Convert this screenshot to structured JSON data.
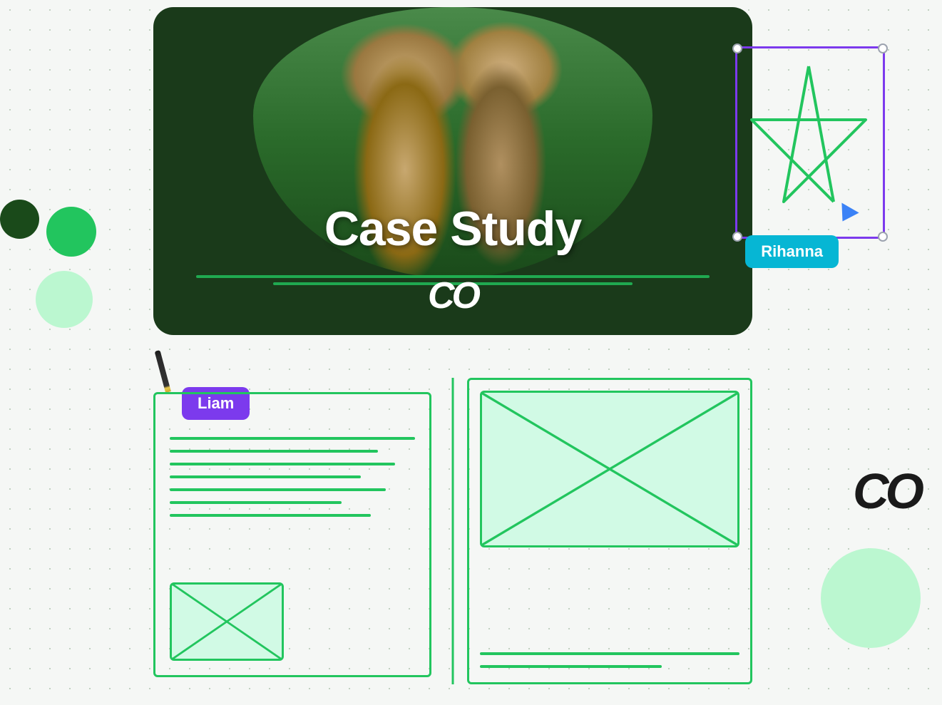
{
  "page": {
    "background_color": "#f5f7f5"
  },
  "decorations": {
    "circle_dark_color": "#1a4a1a",
    "circle_med_color": "#22c55e",
    "circle_light_color": "#bbf7d0",
    "circle_large_light_color": "#bbf7d0"
  },
  "case_study_card": {
    "title": "Case Study",
    "logo": "CO",
    "background": "#1a3a1a"
  },
  "badges": {
    "rihanna": "Rihanna",
    "liam": "Liam"
  },
  "co_logo_large": "CO",
  "selection_box_color": "#7c3aed",
  "cursor_color": "#3b82f6",
  "star_color": "#22c55e"
}
